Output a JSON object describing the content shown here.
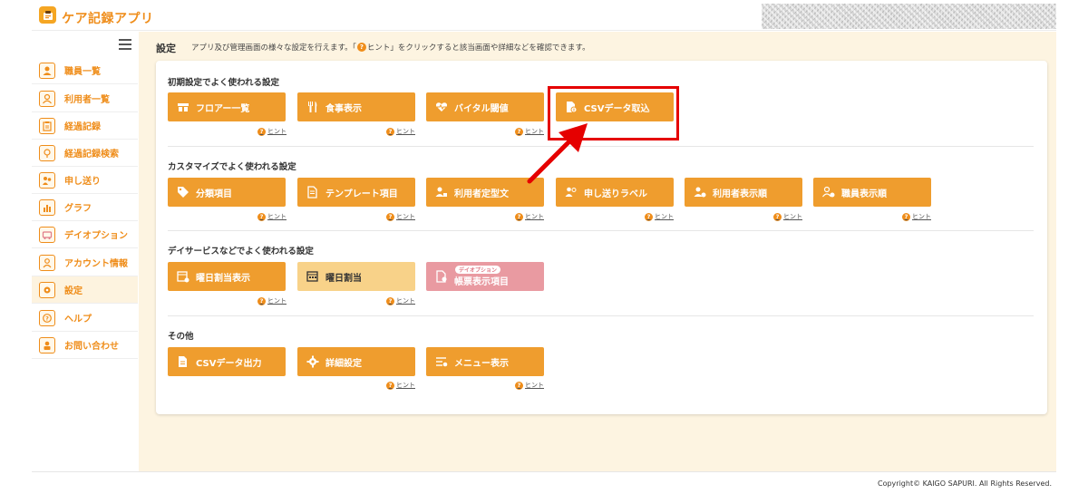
{
  "header": {
    "app_title": "ケア記録アプリ",
    "logo_icon": "care-record-logo-icon"
  },
  "sidebar": {
    "menu_icon": "hamburger-icon",
    "items": [
      {
        "label": "職員一覧",
        "icon": "staff-icon"
      },
      {
        "label": "利用者一覧",
        "icon": "user-icon"
      },
      {
        "label": "経過記録",
        "icon": "clipboard-icon"
      },
      {
        "label": "経過記録検索",
        "icon": "search-record-icon"
      },
      {
        "label": "申し送り",
        "icon": "handover-icon"
      },
      {
        "label": "グラフ",
        "icon": "graph-icon"
      },
      {
        "label": "デイオプション",
        "icon": "day-option-icon"
      },
      {
        "label": "アカウント情報",
        "icon": "account-icon"
      },
      {
        "label": "設定",
        "icon": "settings-icon"
      },
      {
        "label": "ヘルプ",
        "icon": "help-icon"
      },
      {
        "label": "お問い合わせ",
        "icon": "contact-icon"
      }
    ],
    "active_item": "設定"
  },
  "page": {
    "title": "設定",
    "description_before": "アプリ及び管理画面の様々な設定を行えます。「",
    "description_hint_icon": "?",
    "description_hint": "ヒント",
    "description_after": "」をクリックすると該当画面や詳細などを確認できます。"
  },
  "hint_label": "ヒント",
  "sections": [
    {
      "title": "初期設定でよく使われる設定",
      "tiles": [
        {
          "label": "フロアー一覧",
          "icon": "floor-icon"
        },
        {
          "label": "食事表示",
          "icon": "fork-knife-icon"
        },
        {
          "label": "バイタル閾値",
          "icon": "vital-heart-icon"
        },
        {
          "label": "CSVデータ取込",
          "icon": "csv-import-icon"
        }
      ]
    },
    {
      "title": "カスタマイズでよく使われる設定",
      "tiles": [
        {
          "label": "分類項目",
          "icon": "tag-icon"
        },
        {
          "label": "テンプレート項目",
          "icon": "template-icon"
        },
        {
          "label": "利用者定型文",
          "icon": "user-phrase-icon"
        },
        {
          "label": "申し送りラベル",
          "icon": "handover-label-icon"
        },
        {
          "label": "利用者表示順",
          "icon": "user-order-icon"
        },
        {
          "label": "職員表示順",
          "icon": "staff-order-icon"
        }
      ]
    },
    {
      "title": "デイサービスなどでよく使われる設定",
      "tiles": [
        {
          "label": "曜日割当表示",
          "icon": "calendar-check-icon"
        },
        {
          "label": "曜日割当",
          "icon": "calendar-icon"
        },
        {
          "label": "帳票表示項目",
          "icon": "report-icon",
          "badge": "デイオプション"
        }
      ]
    },
    {
      "title": "その他",
      "tiles": [
        {
          "label": "CSVデータ出力",
          "icon": "csv-export-icon"
        },
        {
          "label": "詳細設定",
          "icon": "gear-icon"
        },
        {
          "label": "メニュー表示",
          "icon": "menu-list-icon"
        }
      ]
    }
  ],
  "footer": {
    "copyright": "Copyright© KAIGO SAPURI. All Rights Reserved."
  },
  "colors": {
    "accent": "#ef8d1a",
    "tile": "#ef9d2e",
    "tile_light": "#f8d289",
    "tile_pink": "#e99aa1",
    "main_bg": "#fdf4e1",
    "highlight": "#e50000"
  }
}
